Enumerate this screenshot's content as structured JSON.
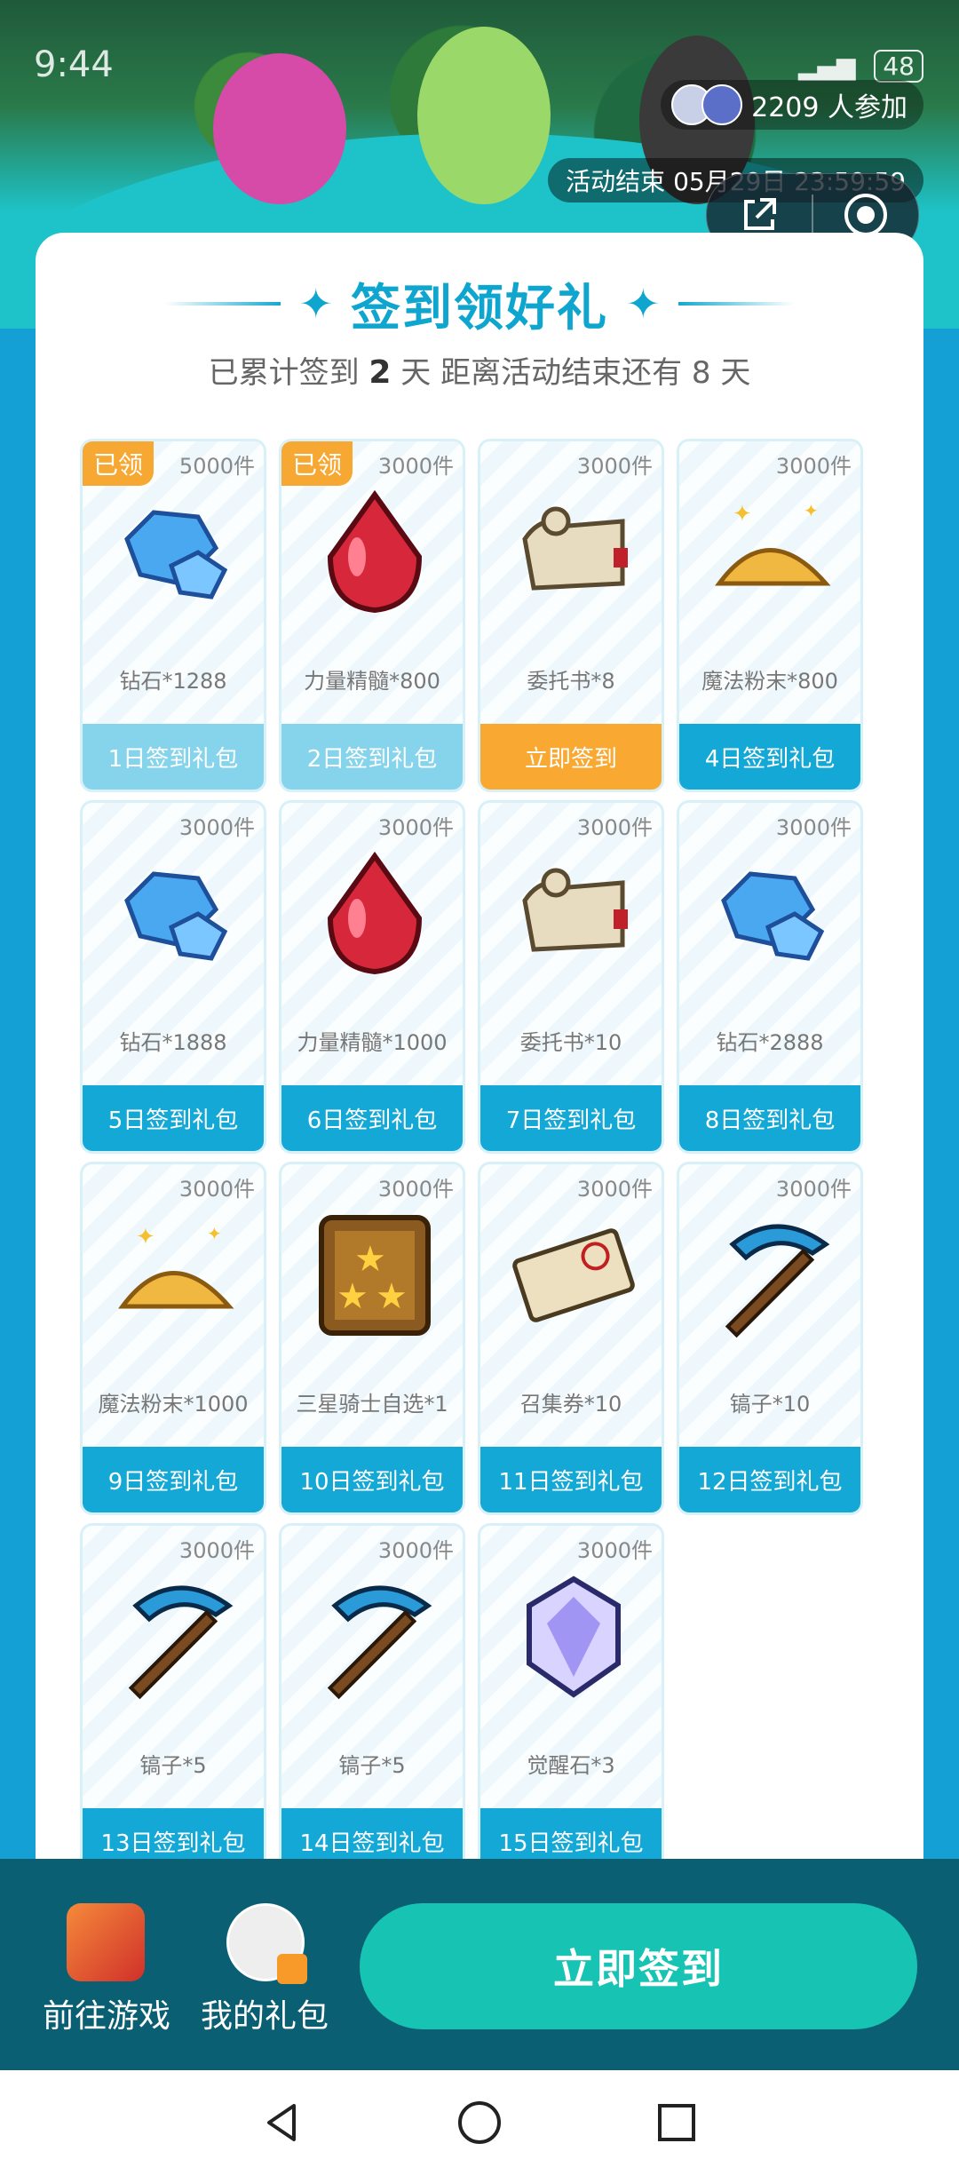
{
  "status": {
    "time": "9:44",
    "battery": "48"
  },
  "banner": {
    "participants": "2209 人参加",
    "end_time": "活动结束 05月29日 23:59:59"
  },
  "card": {
    "title": "签到领好礼",
    "subtitle_prefix": "已累计签到",
    "days_signed": "2",
    "subtitle_mid": "天  距离活动结束还有",
    "days_left": "8",
    "subtitle_suffix": "天"
  },
  "rewards": [
    {
      "qty": "5000件",
      "name": "钻石*1288",
      "button": "1日签到礼包",
      "claimed": "已领",
      "state": "done",
      "icon": "diamond-icon"
    },
    {
      "qty": "3000件",
      "name": "力量精髓*800",
      "button": "2日签到礼包",
      "claimed": "已领",
      "state": "done",
      "icon": "red-gem-icon"
    },
    {
      "qty": "3000件",
      "name": "委托书*8",
      "button": "立即签到",
      "state": "now",
      "icon": "scroll-icon"
    },
    {
      "qty": "3000件",
      "name": "魔法粉末*800",
      "button": "4日签到礼包",
      "state": "todo",
      "icon": "gold-dust-icon"
    },
    {
      "qty": "3000件",
      "name": "钻石*1888",
      "button": "5日签到礼包",
      "state": "todo",
      "icon": "diamond-icon"
    },
    {
      "qty": "3000件",
      "name": "力量精髓*1000",
      "button": "6日签到礼包",
      "state": "todo",
      "icon": "red-gem-icon"
    },
    {
      "qty": "3000件",
      "name": "委托书*10",
      "button": "7日签到礼包",
      "state": "todo",
      "icon": "scroll-icon"
    },
    {
      "qty": "3000件",
      "name": "钻石*2888",
      "button": "8日签到礼包",
      "state": "todo",
      "icon": "diamond-icon"
    },
    {
      "qty": "3000件",
      "name": "魔法粉末*1000",
      "button": "9日签到礼包",
      "state": "todo",
      "icon": "gold-dust-icon"
    },
    {
      "qty": "3000件",
      "name": "三星骑士自选*1",
      "button": "10日签到礼包",
      "state": "todo",
      "icon": "star-badge-icon"
    },
    {
      "qty": "3000件",
      "name": "召集券*10",
      "button": "11日签到礼包",
      "state": "todo",
      "icon": "ticket-icon"
    },
    {
      "qty": "3000件",
      "name": "镐子*10",
      "button": "12日签到礼包",
      "state": "todo",
      "icon": "pickaxe-icon"
    },
    {
      "qty": "3000件",
      "name": "镐子*5",
      "button": "13日签到礼包",
      "state": "todo",
      "icon": "pickaxe-icon"
    },
    {
      "qty": "3000件",
      "name": "镐子*5",
      "button": "14日签到礼包",
      "state": "todo",
      "icon": "pickaxe-icon"
    },
    {
      "qty": "3000件",
      "name": "觉醒石*3",
      "button": "15日签到礼包",
      "state": "todo",
      "icon": "crystal-icon"
    }
  ],
  "bottom": {
    "go_game": "前往游戏",
    "my_gifts": "我的礼包",
    "cta": "立即签到"
  }
}
